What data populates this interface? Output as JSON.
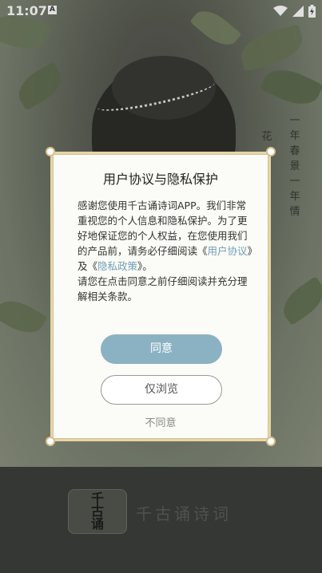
{
  "status_bar": {
    "time": "11:07",
    "notification_icon": "A",
    "icons": [
      "wifi-icon",
      "signal-icon",
      "battery-icon"
    ]
  },
  "background": {
    "poem_col1": "一年春景一年情",
    "poem_col2": "花",
    "logo_text": "千古诵",
    "app_name": "千古诵诗词"
  },
  "dialog": {
    "title": "用户协议与隐私保护",
    "body_1": "感谢您使用千古诵诗词APP。我们非常重视您的个人信息和隐私保护。为了更好地保证您的个人权益，在您使用我们的产品前，请务必仔细阅读《",
    "user_agreement_link": "用户协议",
    "body_2": "》及《",
    "privacy_policy_link": "隐私政策",
    "body_3": "》。",
    "body_4": "请您在点击同意之前仔细阅读并充分理解相关条款。",
    "agree_label": "同意",
    "browse_label": "仅浏览",
    "disagree_label": "不同意"
  },
  "colors": {
    "accent": "#8bb2c3",
    "link": "#6f9fb5",
    "border": "#e7d4a6"
  }
}
